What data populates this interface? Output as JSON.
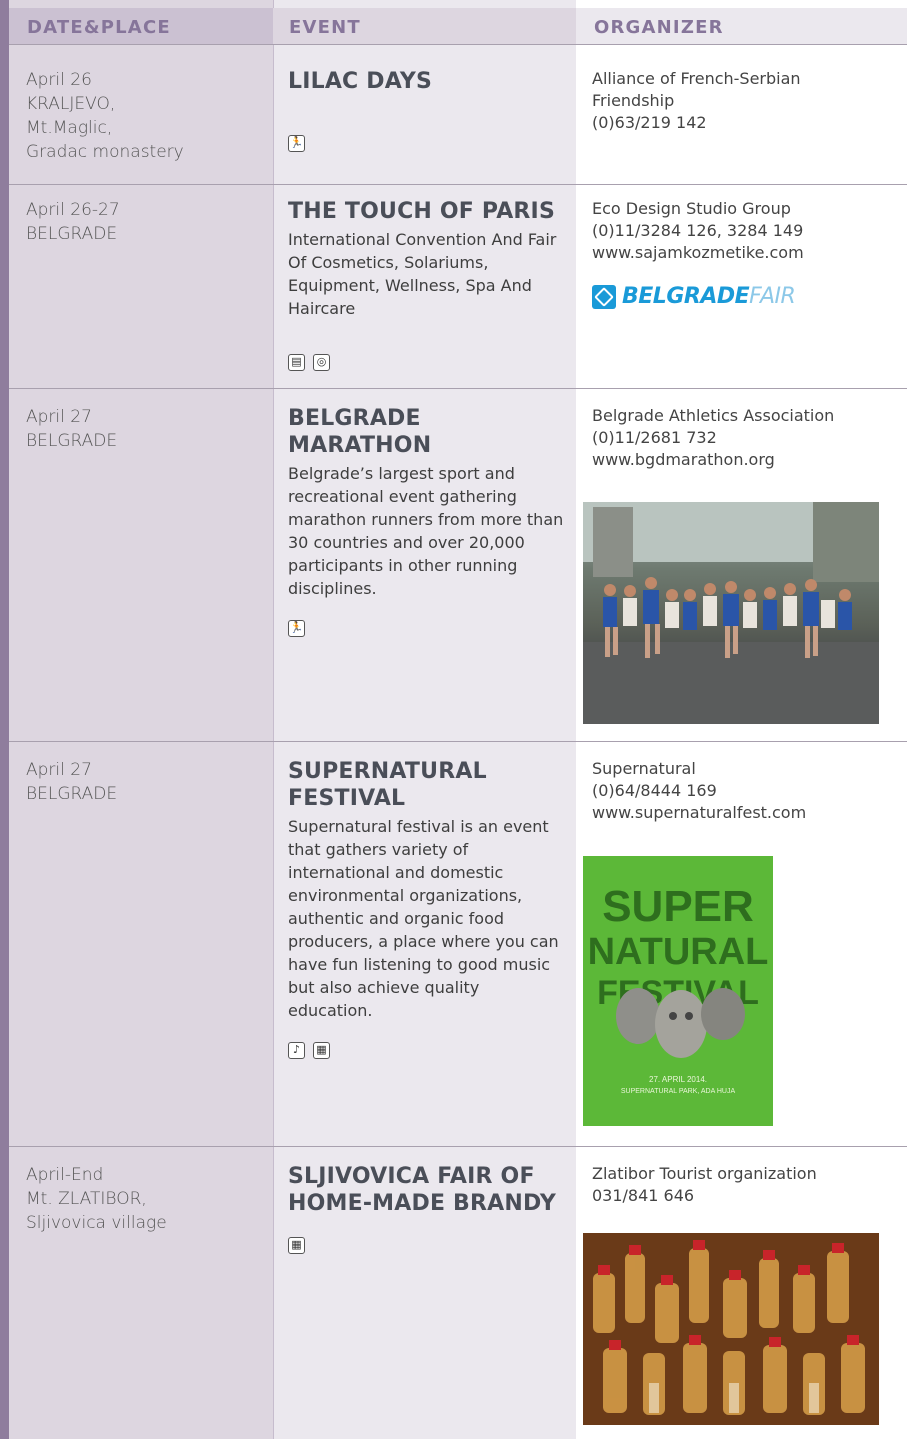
{
  "header": {
    "date_place": "DATE&PLACE",
    "event": "EVENT",
    "organizer": "ORGANIZER"
  },
  "rows": [
    {
      "date": [
        "April 26",
        "KRALJEVO,",
        "Mt.Maglic,",
        "Gradac monastery"
      ],
      "title": "LILAC DAYS",
      "desc": "",
      "icons": [
        "running-person-icon"
      ],
      "org": [
        "Alliance of French-Serbian",
        "Friendship",
        "(0)63/219 142"
      ]
    },
    {
      "date": [
        "April 26-27",
        "BELGRADE"
      ],
      "title": "THE TOUCH OF PARIS",
      "desc": "International Convention And Fair Of Cosmetics, Solariums, Equipment, Wellness, Spa And Haircare",
      "icons": [
        "exhibition-icon",
        "globe-icon"
      ],
      "org": [
        "Eco Design Studio Group",
        "(0)11/3284 126, 3284 149",
        "www.sajamkozmetike.com"
      ],
      "logo": {
        "bold": "BELGRADE",
        "light": "FAIR",
        "color": "#1a9ad8"
      }
    },
    {
      "date": [
        "April 27",
        "BELGRADE"
      ],
      "title": "BELGRADE MARATHON",
      "desc": "Belgrade’s largest sport and recreational event gathering marathon runners from more than 30 countries and over 20,000 participants in other running disciplines.",
      "icons": [
        "running-person-icon"
      ],
      "org": [
        "Belgrade Athletics Association",
        "(0)11/2681 732",
        "www.bgdmarathon.org"
      ]
    },
    {
      "date": [
        "April 27",
        "BELGRADE"
      ],
      "title": "SUPERNATURAL FESTIVAL",
      "desc": "Supernatural festival is an event that gathers variety of international and domestic environmental organizations, authentic and organic food producers, a place where you can have fun listening to good music but also achieve quality education.",
      "icons": [
        "music-icon",
        "market-icon"
      ],
      "org": [
        "Supernatural",
        "(0)64/8444 169",
        "www.supernaturalfest.com"
      ],
      "poster": {
        "lines": [
          "SUPER",
          "NATURAL",
          "FESTIVAL"
        ],
        "date_line": "27. APRIL 2014.",
        "place_line": "SUPERNATURAL PARK, ADA HUJA"
      }
    },
    {
      "date": [
        "April-End",
        "Mt. ZLATIBOR,",
        "Sljivovica village"
      ],
      "title": "SLJIVOVICA FAIR OF HOME-MADE BRANDY",
      "desc": "",
      "icons": [
        "market-icon"
      ],
      "org": [
        "Zlatibor Tourist organization",
        "031/841 646"
      ]
    }
  ]
}
